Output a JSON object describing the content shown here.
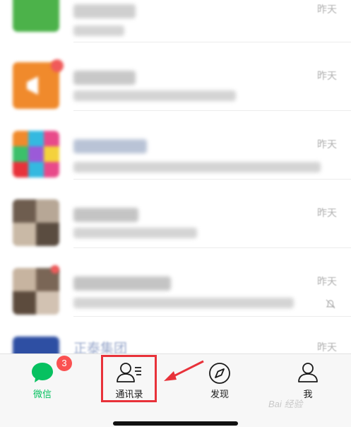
{
  "chat_list": {
    "rows": [
      {
        "time": "昨天"
      },
      {
        "time": "昨天"
      },
      {
        "time": "昨天"
      },
      {
        "time": "昨天"
      },
      {
        "time": "昨天"
      },
      {
        "time": "昨天",
        "name": "正泰集团"
      }
    ]
  },
  "tabbar": {
    "tabs": [
      {
        "label": "微信",
        "badge": "3"
      },
      {
        "label": "通讯录"
      },
      {
        "label": "发现"
      },
      {
        "label": "我"
      }
    ]
  },
  "watermark": "Bai 经验",
  "colors": {
    "active": "#07c160",
    "badge": "#fa5151",
    "highlight": "#e8323a"
  }
}
